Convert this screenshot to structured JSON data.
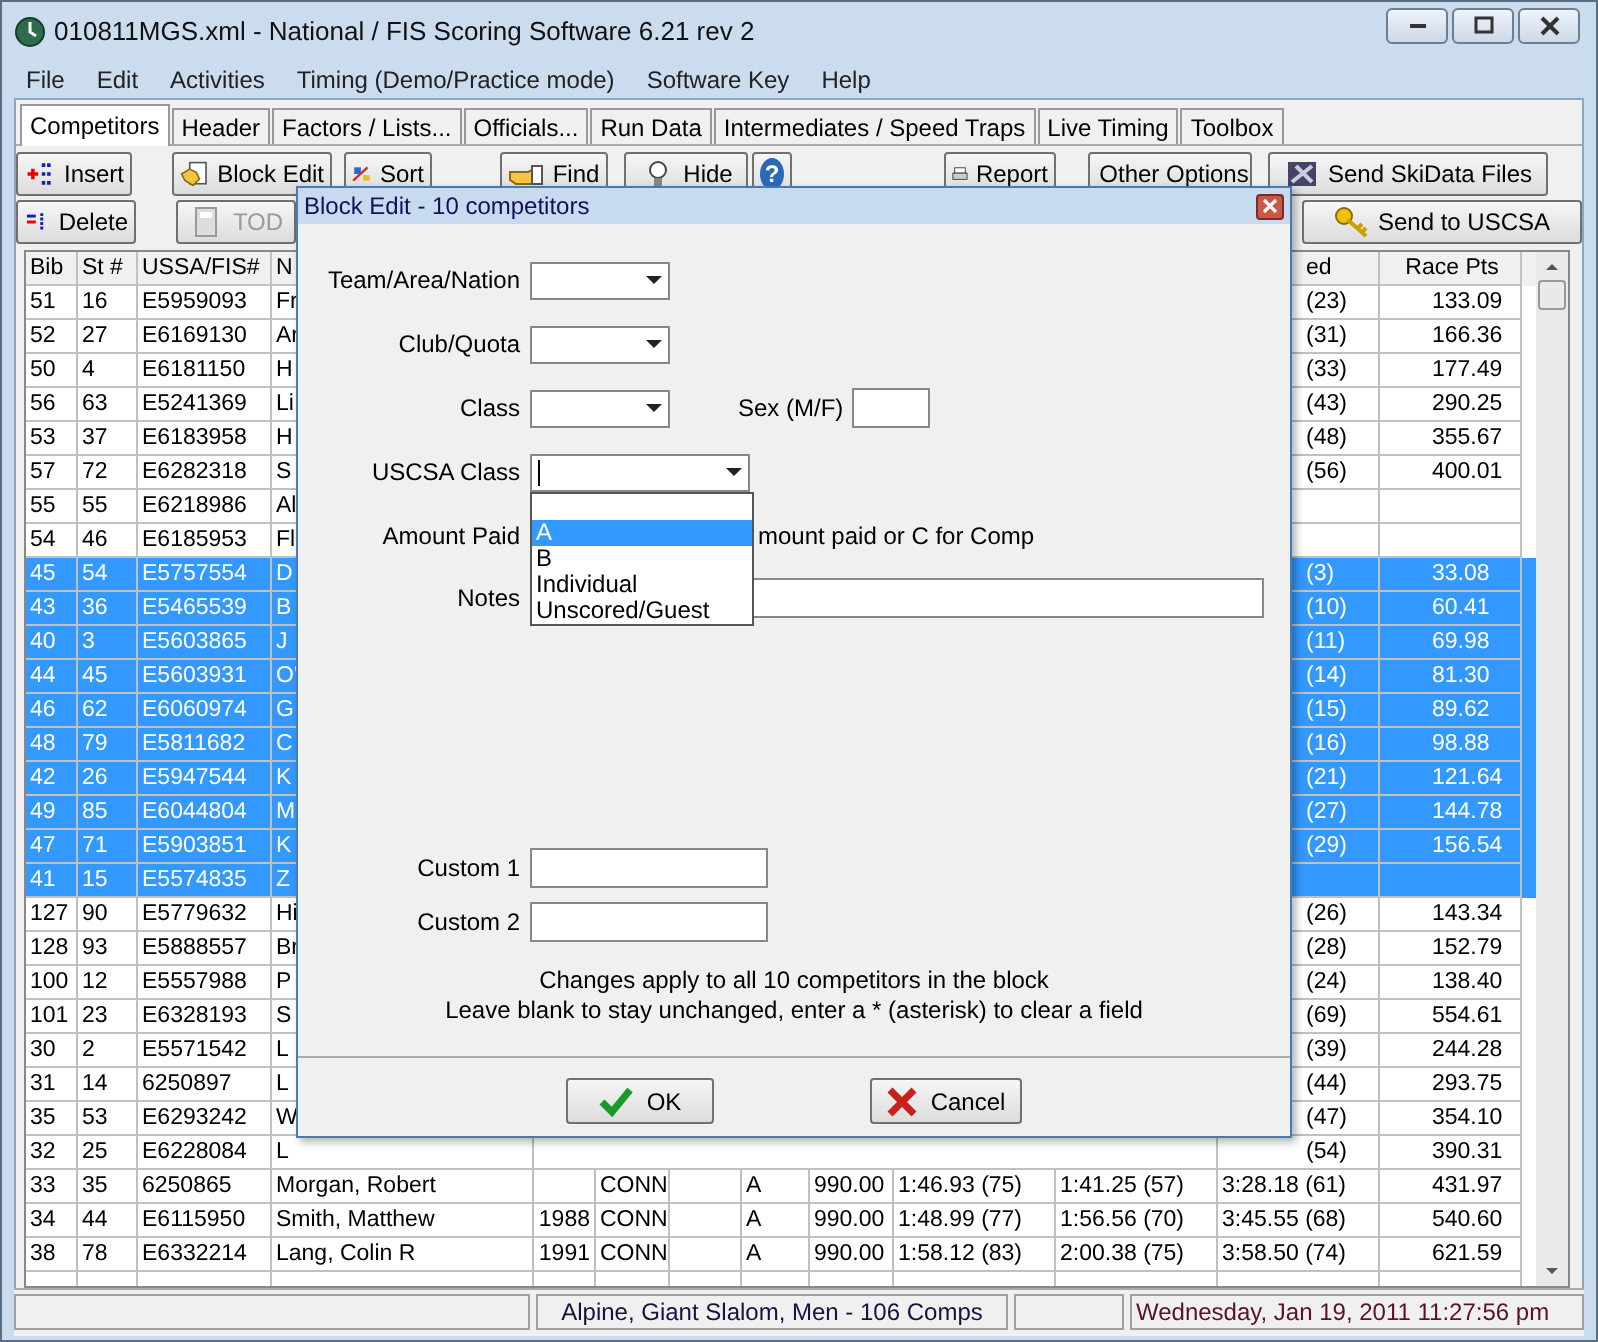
{
  "window": {
    "title": "010811MGS.xml - National / FIS Scoring Software 6.21 rev 2"
  },
  "menu": [
    "File",
    "Edit",
    "Activities",
    "Timing (Demo/Practice mode)",
    "Software Key",
    "Help"
  ],
  "tabs": [
    {
      "label": "Competitors",
      "selected": true
    },
    {
      "label": "Header",
      "selected": false
    },
    {
      "label": "Factors / Lists...",
      "selected": false
    },
    {
      "label": "Officials...",
      "selected": false
    },
    {
      "label": "Run Data",
      "selected": false
    },
    {
      "label": "Intermediates / Speed Traps",
      "selected": false
    },
    {
      "label": "Live Timing",
      "selected": false
    },
    {
      "label": "Toolbox",
      "selected": false
    }
  ],
  "toolbar_rows": [
    [
      {
        "label": "Insert",
        "kind": "insert",
        "disabled": false
      },
      {
        "label": "Block Edit",
        "kind": "blockedit",
        "disabled": false
      },
      {
        "label": "Sort",
        "kind": "sort",
        "disabled": false
      },
      {
        "label": "Find",
        "kind": "find",
        "disabled": false
      },
      {
        "label": "Hide",
        "kind": "hide",
        "disabled": false
      },
      {
        "label": "?",
        "kind": "help",
        "disabled": false
      },
      {
        "label": "Report",
        "kind": "report",
        "disabled": false
      },
      {
        "label": "Other Options",
        "kind": "options",
        "disabled": false
      },
      {
        "label": "Send SkiData Files",
        "kind": "skidata",
        "disabled": false
      }
    ],
    [
      {
        "label": "Delete",
        "kind": "delete",
        "disabled": false
      },
      {
        "label": "TOD",
        "kind": "tod",
        "disabled": true
      },
      {
        "label": "Send to USCSA",
        "kind": "uscsa",
        "disabled": false
      }
    ]
  ],
  "table": {
    "columns": [
      "Bib",
      "St #",
      "USSA/FIS#",
      "N",
      "ed",
      "Race Pts"
    ],
    "rows": [
      {
        "bib": "51",
        "st": "16",
        "id": "E5959093",
        "name": "Fr",
        "combined": "(23)",
        "race_pts": "133.09",
        "selected": false
      },
      {
        "bib": "52",
        "st": "27",
        "id": "E6169130",
        "name": "Ar",
        "combined": "(31)",
        "race_pts": "166.36",
        "selected": false
      },
      {
        "bib": "50",
        "st": "4",
        "id": "E6181150",
        "name": "H",
        "combined": "(33)",
        "race_pts": "177.49",
        "selected": false
      },
      {
        "bib": "56",
        "st": "63",
        "id": "E5241369",
        "name": "Li",
        "combined": "(43)",
        "race_pts": "290.25",
        "selected": false
      },
      {
        "bib": "53",
        "st": "37",
        "id": "E6183958",
        "name": "H",
        "combined": "(48)",
        "race_pts": "355.67",
        "selected": false
      },
      {
        "bib": "57",
        "st": "72",
        "id": "E6282318",
        "name": "S",
        "combined": "(56)",
        "race_pts": "400.01",
        "selected": false
      },
      {
        "bib": "55",
        "st": "55",
        "id": "E6218986",
        "name": "Al",
        "selected": false
      },
      {
        "bib": "54",
        "st": "46",
        "id": "E6185953",
        "name": "Fl",
        "selected": false
      },
      {
        "bib": "45",
        "st": "54",
        "id": "E5757554",
        "name": "D",
        "combined": "(3)",
        "race_pts": "33.08",
        "selected": true
      },
      {
        "bib": "43",
        "st": "36",
        "id": "E5465539",
        "name": "B",
        "combined": "(10)",
        "race_pts": "60.41",
        "selected": true
      },
      {
        "bib": "40",
        "st": "3",
        "id": "E5603865",
        "name": "J",
        "combined": "(11)",
        "race_pts": "69.98",
        "selected": true
      },
      {
        "bib": "44",
        "st": "45",
        "id": "E5603931",
        "name": "O'",
        "combined": "(14)",
        "race_pts": "81.30",
        "selected": true
      },
      {
        "bib": "46",
        "st": "62",
        "id": "E6060974",
        "name": "G",
        "combined": "(15)",
        "race_pts": "89.62",
        "selected": true
      },
      {
        "bib": "48",
        "st": "79",
        "id": "E5811682",
        "name": "C",
        "combined": "(16)",
        "race_pts": "98.88",
        "selected": true
      },
      {
        "bib": "42",
        "st": "26",
        "id": "E5947544",
        "name": "K",
        "combined": "(21)",
        "race_pts": "121.64",
        "selected": true
      },
      {
        "bib": "49",
        "st": "85",
        "id": "E6044804",
        "name": "M",
        "combined": "(27)",
        "race_pts": "144.78",
        "selected": true
      },
      {
        "bib": "47",
        "st": "71",
        "id": "E5903851",
        "name": "K",
        "combined": "(29)",
        "race_pts": "156.54",
        "selected": true
      },
      {
        "bib": "41",
        "st": "15",
        "id": "E5574835",
        "name": "Z",
        "selected": true
      },
      {
        "bib": "127",
        "st": "90",
        "id": "E5779632",
        "name": "Hi",
        "combined": "(26)",
        "race_pts": "143.34",
        "selected": false
      },
      {
        "bib": "128",
        "st": "93",
        "id": "E5888557",
        "name": "Br",
        "combined": "(28)",
        "race_pts": "152.79",
        "selected": false
      },
      {
        "bib": "100",
        "st": "12",
        "id": "E5557988",
        "name": "P",
        "combined": "(24)",
        "race_pts": "138.40",
        "selected": false
      },
      {
        "bib": "101",
        "st": "23",
        "id": "E6328193",
        "name": "S",
        "combined": "(69)",
        "race_pts": "554.61",
        "selected": false
      },
      {
        "bib": "30",
        "st": "2",
        "id": "E5571542",
        "name": "L",
        "combined": "(39)",
        "race_pts": "244.28",
        "selected": false
      },
      {
        "bib": "31",
        "st": "14",
        "id": "6250897",
        "name": "L",
        "combined": "(44)",
        "race_pts": "293.75",
        "selected": false
      },
      {
        "bib": "35",
        "st": "53",
        "id": "E6293242",
        "name": "W",
        "combined": "(47)",
        "race_pts": "354.10",
        "selected": false
      },
      {
        "bib": "32",
        "st": "25",
        "id": "E6228084",
        "name": "L",
        "combined": "(54)",
        "race_pts": "390.31",
        "selected": false
      },
      {
        "bib": "33",
        "st": "35",
        "id": "6250865",
        "name": "Morgan, Robert",
        "club": "CONN",
        "class": "A",
        "fee": "990.00",
        "run1": "1:46.93 (75)",
        "run2": "1:41.25 (57)",
        "combined": "3:28.18 (61)",
        "race_pts": "431.97",
        "selected": false
      },
      {
        "bib": "34",
        "st": "44",
        "id": "E6115950",
        "name": "Smith, Matthew",
        "year": "1988",
        "club": "CONN",
        "class": "A",
        "fee": "990.00",
        "run1": "1:48.99 (77)",
        "run2": "1:56.56 (70)",
        "combined": "3:45.55 (68)",
        "race_pts": "540.60",
        "selected": false
      },
      {
        "bib": "38",
        "st": "78",
        "id": "E6332214",
        "name": "Lang, Colin R",
        "year": "1991",
        "club": "CONN",
        "class": "A",
        "fee": "990.00",
        "run1": "1:58.12 (83)",
        "run2": "2:00.38 (75)",
        "combined": "3:58.50 (74)",
        "race_pts": "621.59",
        "selected": false
      }
    ]
  },
  "dialog": {
    "title": "Block Edit - 10 competitors",
    "fields": [
      {
        "label": "Team/Area/Nation",
        "kind": "combo"
      },
      {
        "label": "Club/Quota",
        "kind": "combo"
      },
      {
        "label": "Class",
        "kind": "combo",
        "extra_label": "Sex (M/F)"
      },
      {
        "label": "USCSA Class",
        "kind": "open-combo",
        "options": [
          {
            "label": "A",
            "selected": true
          },
          {
            "label": "B",
            "selected": false
          },
          {
            "label": "Individual",
            "selected": false
          },
          {
            "label": "Unscored/Guest",
            "selected": false
          }
        ]
      },
      {
        "label": "Amount Paid",
        "kind": "hint",
        "hint": "mount paid or C for Comp"
      },
      {
        "label": "Notes",
        "kind": "notes"
      },
      {
        "label": "Custom 1",
        "kind": "text"
      },
      {
        "label": "Custom 2",
        "kind": "text"
      }
    ],
    "notes": [
      "Changes apply to all 10 competitors in the block",
      "Leave blank to stay unchanged, enter a * (asterisk) to clear a field"
    ],
    "buttons": [
      {
        "label": "OK",
        "kind": "ok"
      },
      {
        "label": "Cancel",
        "kind": "cancel"
      }
    ]
  },
  "status_bar": {
    "event": "Alpine, Giant Slalom, Men - 106 Comps",
    "datetime": "Wednesday, Jan 19, 2011  11:27:56 pm"
  }
}
